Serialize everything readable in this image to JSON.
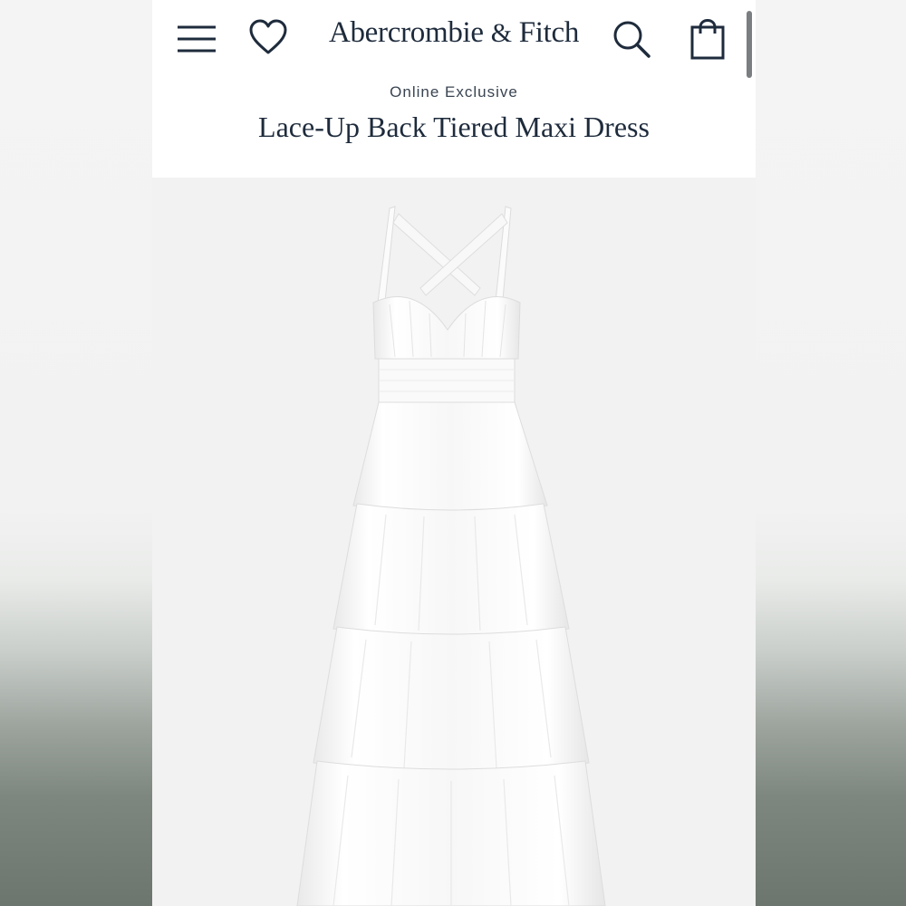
{
  "header": {
    "brand_name": "Abercrombie",
    "brand_amp": "&",
    "brand_name_2": "Fitch",
    "icons": {
      "menu": "hamburger-menu-icon",
      "wishlist": "heart-icon",
      "search": "search-icon",
      "bag": "shopping-bag-icon"
    }
  },
  "product": {
    "eyebrow": "Online Exclusive",
    "title": "Lace-Up Back Tiered Maxi Dress",
    "image": "white-tiered-maxi-dress-photo"
  },
  "colors": {
    "brand_navy": "#1e2b3c",
    "image_background": "#f2f2f2",
    "dress_white": "#ffffff"
  }
}
